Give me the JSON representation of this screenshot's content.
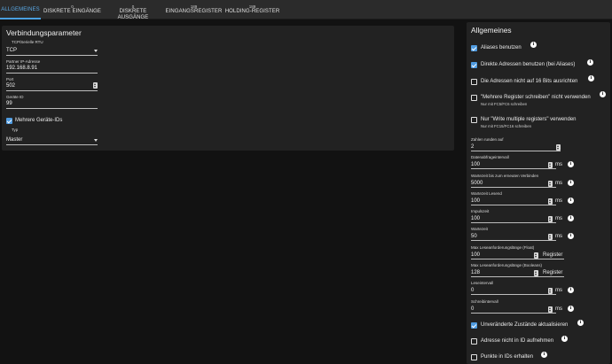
{
  "tabs": [
    {
      "label": "ALLGEMEINES",
      "badge": "",
      "active": true
    },
    {
      "label": "DISKRETE EINGÄNGE",
      "badge": "0",
      "active": false
    },
    {
      "label": "DISKRETE AUSGÄNGE",
      "badge": "0",
      "active": false
    },
    {
      "label": "EINGANGSREGISTER",
      "badge": "189",
      "active": false
    },
    {
      "label": "HOLDING-REGISTER",
      "badge": "189",
      "active": false
    }
  ],
  "connection": {
    "title": "Verbindungsparameter",
    "type_label": "TCP/Serielle RTU",
    "type_value": "TCP",
    "ip_label": "Partner IP-Adresse",
    "ip_value": "192.168.8.91",
    "port_label": "Port",
    "port_value": "502",
    "device_id_label": "Geräte ID",
    "device_id_value": "99",
    "multiple_ids_label": "Mehrere Geräte-IDs",
    "multiple_ids_checked": true,
    "mode_label": "Typ",
    "mode_value": "Master"
  },
  "general": {
    "title": "Allgemeines",
    "aliases_label": "Aliases benutzen",
    "direct_addresses_label": "Direkte Adressen benutzen (bei Aliases)",
    "no_align_label": "Die Adressen nicht auf 16 Bits ausrichten",
    "multiple_registers_label": "\"Mehrere Register schreiben\" nicht verwenden",
    "multiple_registers_hint": "Nur mit FC5/FC6 schreiben",
    "write_multiple_label": "Nur \"Write multiple registers\" verwenden",
    "write_multiple_hint": "Nur mit FC15/FC16 schreiben",
    "round_label": "Zahlen runden auf",
    "round_value": "2",
    "poll_label": "Datenabfrageintervall",
    "poll_value": "100",
    "poll_unit": "ms",
    "reconnect_label": "Wartezeit bis zum erneuten Verbinden",
    "reconnect_value": "5000",
    "reconnect_unit": "ms",
    "read_timeout_label": "Wartezeit Lesend",
    "read_timeout_value": "100",
    "read_timeout_unit": "ms",
    "pulse_label": "Impulszeit",
    "pulse_value": "100",
    "pulse_unit": "ms",
    "wait_label": "Wartezeit",
    "wait_value": "50",
    "wait_unit": "ms",
    "max_float_label": "Max Leseanforderungslänge (Float)",
    "max_float_value": "100",
    "max_float_unit": "Register",
    "max_bool_label": "Max Leseanforderungslänge (Booleans)",
    "max_bool_value": "128",
    "max_bool_unit": "Register",
    "read_interval_label": "Leseintervall",
    "read_interval_value": "0",
    "read_interval_unit": "ms",
    "write_interval_label": "Schreibintervall",
    "write_interval_value": "0",
    "write_interval_unit": "ms",
    "update_unchanged_label": "Unveränderte Zustände aktualisieren",
    "no_address_in_id_label": "Adresse nicht in ID aufnehmen",
    "keep_dots_label": "Punkte in IDs erhalten"
  },
  "icons": {
    "info": "i"
  },
  "colors": {
    "accent": "#4f9be0",
    "panel": "#222222",
    "background": "#121212"
  }
}
